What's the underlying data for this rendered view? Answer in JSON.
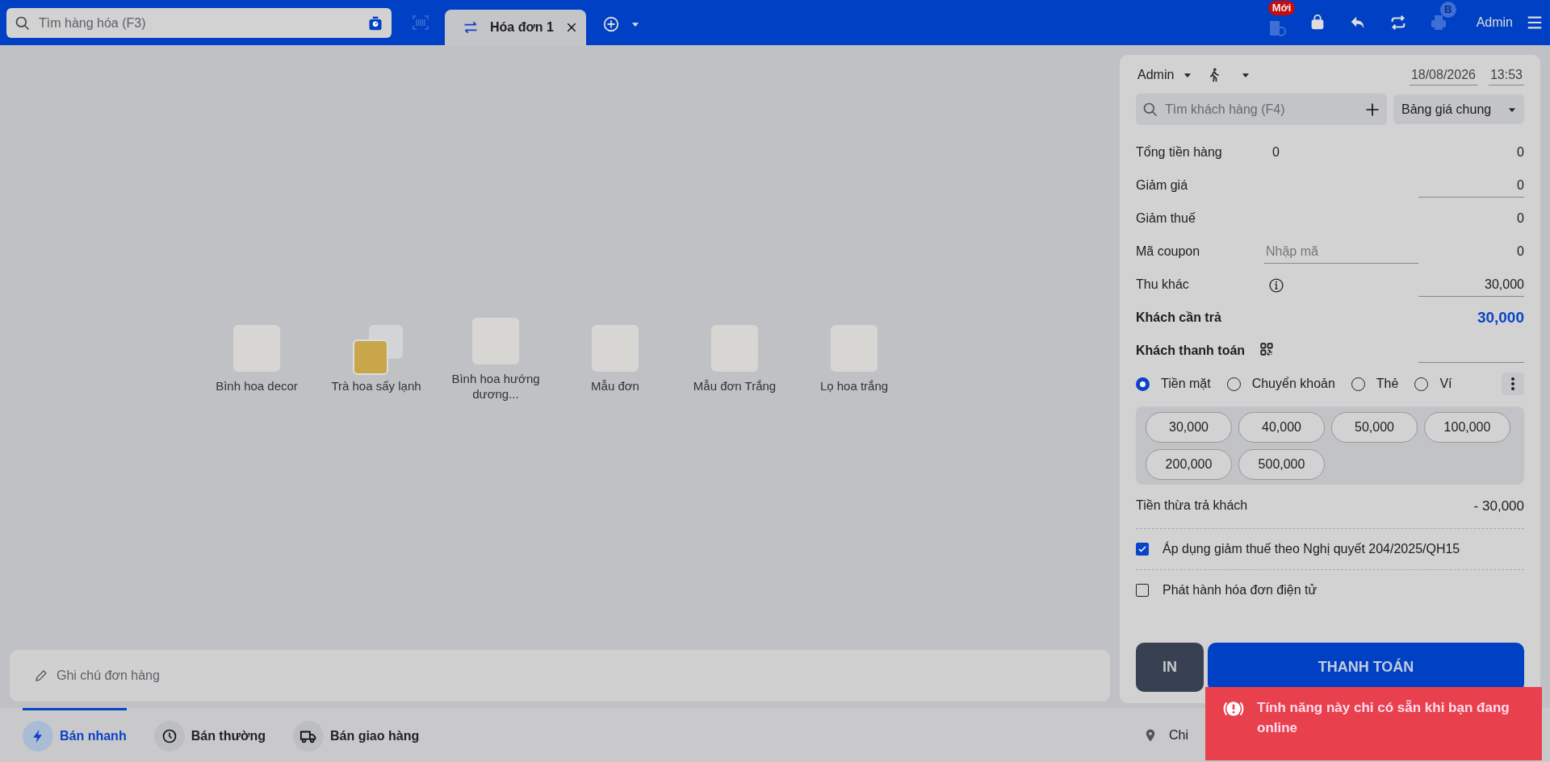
{
  "topbar": {
    "search": {
      "placeholder": "Tìm hàng hóa (F3)"
    },
    "invoice_tabs": [
      {
        "label": "Hóa đơn 1",
        "selected": true
      }
    ],
    "new_badge": "Mới",
    "printer_badge": "B",
    "user": "Admin"
  },
  "products": [
    {
      "name": "Bình hoa decor",
      "kind": "single"
    },
    {
      "name": "Trà hoa sấy lạnh",
      "kind": "group"
    },
    {
      "name": "Bình hoa hướng dương...",
      "kind": "single"
    },
    {
      "name": "Mẫu đơn",
      "kind": "single"
    },
    {
      "name": "Mẫu đơn Trắng",
      "kind": "single"
    },
    {
      "name": "Lọ hoa trắng",
      "kind": "single"
    }
  ],
  "note": {
    "placeholder": "Ghi chú đơn hàng"
  },
  "modes": [
    {
      "label": "Bán nhanh",
      "kind": "fast",
      "selected": true
    },
    {
      "label": "Bán thường",
      "kind": "normal",
      "selected": false
    },
    {
      "label": "Bán giao hàng",
      "kind": "delivery",
      "selected": false
    }
  ],
  "branch": "Chi",
  "checkout": {
    "seller": "Admin",
    "date": "18/08/2026",
    "time": "13:53",
    "customer_search": {
      "placeholder": "Tìm khách hàng (F4)"
    },
    "price_list": "Bảng giá chung",
    "rows": [
      {
        "kind": "total",
        "label": "Tổng tiền hàng",
        "count": "0",
        "value": "0"
      },
      {
        "kind": "input",
        "label": "Giảm giá",
        "value": "0"
      },
      {
        "kind": "plain",
        "label": "Giảm thuế",
        "value": "0"
      },
      {
        "kind": "coupon",
        "label": "Mã coupon",
        "placeholder": "Nhập mã",
        "value": "0"
      },
      {
        "kind": "info",
        "label": "Thu khác",
        "value": "30,000"
      },
      {
        "kind": "due",
        "label": "Khách cần trả",
        "value": "30,000"
      },
      {
        "kind": "pay",
        "label": "Khách thanh toán"
      }
    ],
    "methods": [
      {
        "label": "Tiền mặt",
        "selected": true
      },
      {
        "label": "Chuyển khoản",
        "selected": false
      },
      {
        "label": "Thẻ",
        "selected": false
      },
      {
        "label": "Ví",
        "selected": false
      }
    ],
    "quick_amounts": [
      "30,000",
      "40,000",
      "50,000",
      "100,000",
      "200,000",
      "500,000"
    ],
    "change": {
      "label": "Tiền thừa trả khách",
      "value": "- 30,000"
    },
    "options": [
      {
        "label": "Áp dụng giảm thuế theo Nghị quyết 204/2025/QH15",
        "checked": true
      },
      {
        "label": "Phát hành hóa đơn điện tử",
        "checked": false
      }
    ],
    "print_button": "IN",
    "pay_button": "THANH TOÁN"
  },
  "toast": {
    "message": "Tính năng này chỉ có sẵn khi bạn đang online"
  }
}
